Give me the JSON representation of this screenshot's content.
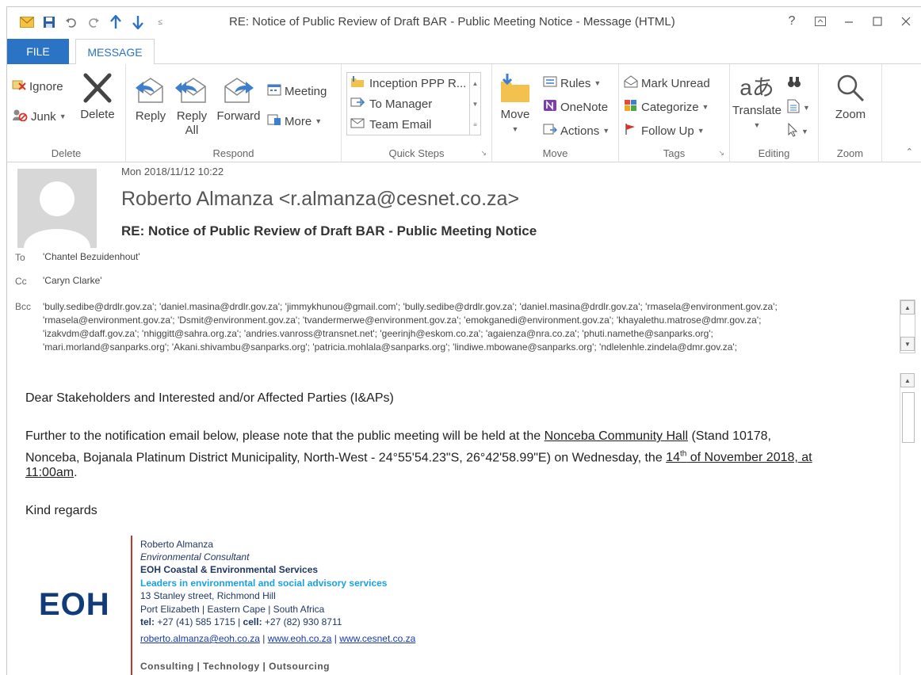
{
  "window": {
    "title": "RE: Notice of Public Review of Draft BAR - Public Meeting Notice - Message (HTML)",
    "help": "?",
    "controls": [
      "restore-ribbon",
      "minimize",
      "maximize",
      "close"
    ]
  },
  "tabs": {
    "file": "FILE",
    "message": "MESSAGE"
  },
  "ribbon": {
    "delete_group": {
      "label": "Delete",
      "ignore": "Ignore",
      "junk": "Junk",
      "delete": "Delete"
    },
    "respond_group": {
      "label": "Respond",
      "reply": "Reply",
      "reply_all_1": "Reply",
      "reply_all_2": "All",
      "forward": "Forward",
      "meeting": "Meeting",
      "more": "More"
    },
    "quicksteps_group": {
      "label": "Quick Steps",
      "items": [
        "Inception PPP R...",
        "To Manager",
        "Team Email"
      ]
    },
    "move_group": {
      "label": "Move",
      "move": "Move",
      "rules": "Rules",
      "onenote": "OneNote",
      "actions": "Actions"
    },
    "tags_group": {
      "label": "Tags",
      "mark_unread": "Mark Unread",
      "categorize": "Categorize",
      "follow_up": "Follow Up"
    },
    "editing_group": {
      "label": "Editing",
      "translate": "Translate"
    },
    "zoom_group": {
      "label": "Zoom",
      "zoom": "Zoom"
    }
  },
  "message": {
    "date": "Mon 2018/11/12 10:22",
    "sender": "Roberto Almanza <r.almanza@cesnet.co.za>",
    "subject": "RE: Notice of Public Review of Draft BAR - Public Meeting Notice",
    "to_label": "To",
    "to": "'Chantel Bezuidenhout'",
    "cc_label": "Cc",
    "cc": "'Caryn Clarke'",
    "bcc_label": "Bcc",
    "bcc_lines": [
      "'bully.sedibe@drdlr.gov.za'; 'daniel.masina@drdlr.gov.za'; 'jimmykhunou@gmail.com'; 'bully.sedibe@drdlr.gov.za'; 'daniel.masina@drdlr.gov.za'; 'rmasela@environment.gov.za';",
      "'rmasela@environment.gov.za'; 'Dsmit@environment.gov.za'; 'tvandermerwe@environment.gov.za'; 'emokganedi@environment.gov.za'; 'khayalethu.matrose@dmr.gov.za';",
      "'izakvdm@daff.gov.za'; 'nhiggitt@sahra.org.za'; 'andries.vanross@transnet.net'; 'geerinjh@eskom.co.za'; 'agaienza@nra.co.za'; 'phuti.namethe@sanparks.org';",
      "'mari.morland@sanparks.org'; 'Akani.shivambu@sanparks.org'; 'patricia.mohlala@sanparks.org'; 'lindiwe.mbowane@sanparks.org'; 'ndlelenhle.zindela@dmr.gov.za';"
    ]
  },
  "body": {
    "greeting": "Dear Stakeholders and Interested and/or Affected Parties (I&APs)",
    "para_1a": "Further to the notification email below, please note that the public meeting will be held at the ",
    "para_1_venue": "Nonceba Community Hall",
    "para_1b": " (Stand 10178,",
    "para_2a": "Nonceba, Bojanala Platinum District Municipality, North-West - 24°55'54.23\"S, 26°42'58.99\"E) on Wednesday, the ",
    "para_2_day": "14",
    "para_2_sup": "th",
    "para_2_rest": " of November 2018, at",
    "para_3": "11:00am",
    "para_3_end": ".",
    "closing": "Kind regards"
  },
  "signature": {
    "logo": "EOH",
    "name": "Roberto Almanza",
    "title": "Environmental Consultant",
    "company": "EOH Coastal & Environmental Services",
    "tagline": "Leaders in environmental and social advisory services",
    "address_1": "13 Stanley street, Richmond Hill",
    "address_2": "Port Elizabeth  | Eastern Cape  |  South Africa",
    "tel_label": "tel:",
    "tel": " +27 (41) 585 1715 | ",
    "cell_label": "cell:",
    "cell": " +27 (82) 930 8711",
    "email": "roberto.almanza@eoh.co.za",
    "sep1": " | ",
    "web1": "www.eoh.co.za",
    "sep2": " | ",
    "web2": "www.cesnet.co.za",
    "footer": "Consulting | Technology | Outsourcing"
  },
  "colors": {
    "accent_blue": "#2b73c5",
    "logo_navy": "#123b7a",
    "tagline_cyan": "#1ba1e2",
    "signature_bar_red": "#c0392b"
  }
}
